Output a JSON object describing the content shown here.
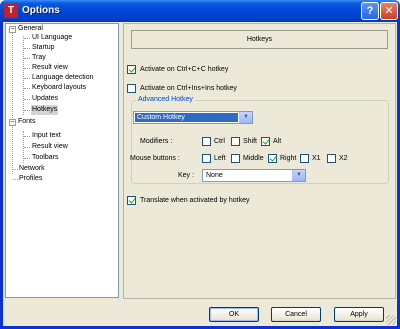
{
  "window": {
    "title": "Options",
    "help_label": "?",
    "close_label": "✕",
    "app_icon_glyph": "T"
  },
  "tree": {
    "items": [
      {
        "label": "General",
        "expander": "−"
      },
      {
        "label": "UI Language"
      },
      {
        "label": "Startup"
      },
      {
        "label": "Tray"
      },
      {
        "label": "Result view"
      },
      {
        "label": "Language detection"
      },
      {
        "label": "Keyboard layouts"
      },
      {
        "label": "Updates"
      },
      {
        "label": "Hotkeys",
        "selected": true
      },
      {
        "label": "Fonts",
        "expander": "−"
      },
      {
        "label": "Input text"
      },
      {
        "label": "Result view"
      },
      {
        "label": "Toolbars"
      },
      {
        "label": "Network"
      },
      {
        "label": "Profiles"
      }
    ]
  },
  "panel": {
    "header": "Hotkeys",
    "activate_ctrl_c": {
      "label": "Activate on Ctrl+C+C hotkey",
      "checked": true
    },
    "activate_ctrl_ins": {
      "label": "Activate on Ctrl+Ins+Ins hotkey",
      "checked": false
    },
    "advanced": {
      "title": "Advanced Hotkey",
      "preset_value": "Custom Hotkey",
      "modifiers_label": "Modifiers :",
      "modifiers": [
        {
          "label": "Ctrl",
          "checked": false
        },
        {
          "label": "Shift",
          "checked": false
        },
        {
          "label": "Alt",
          "checked": true
        }
      ],
      "mouse_label": "Mouse buttons :",
      "mouse_buttons": [
        {
          "label": "Left",
          "checked": false
        },
        {
          "label": "Middle",
          "checked": false
        },
        {
          "label": "Right",
          "checked": true
        },
        {
          "label": "X1",
          "checked": false
        },
        {
          "label": "X2",
          "checked": false
        }
      ],
      "key_label": "Key :",
      "key_value": "None"
    },
    "translate_hotkey": {
      "label": "Translate when activated by hotkey",
      "checked": true
    }
  },
  "buttons": {
    "ok": "OK",
    "cancel": "Cancel",
    "apply": "Apply"
  }
}
